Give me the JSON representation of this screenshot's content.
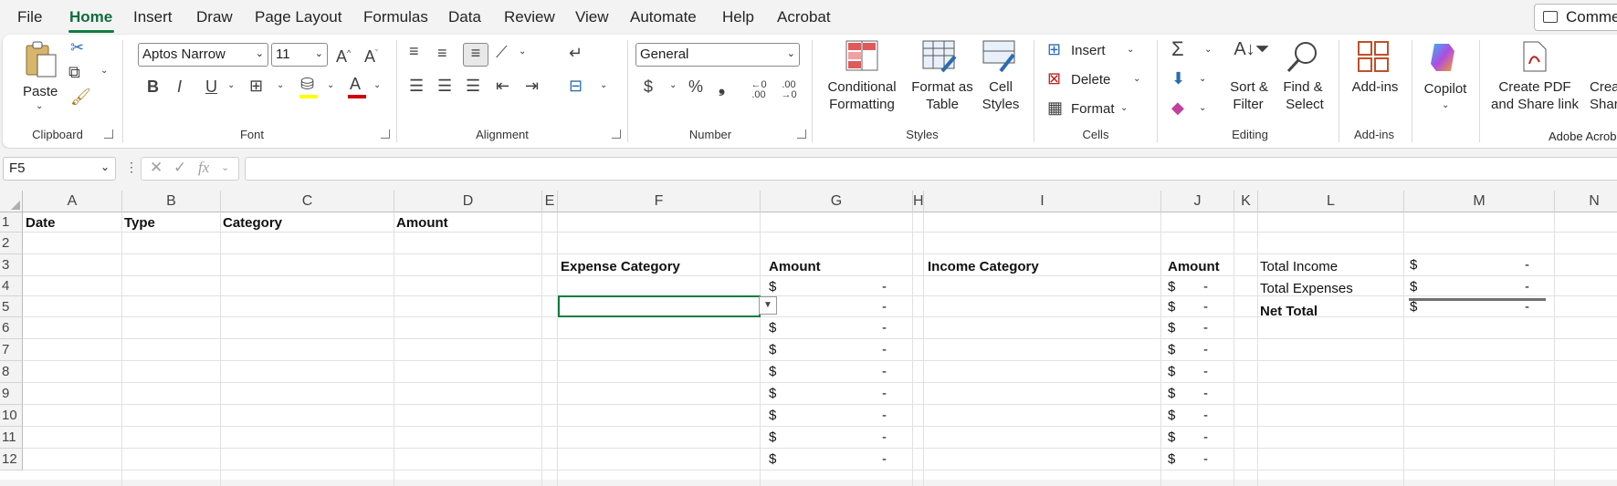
{
  "menu": {
    "tabs": [
      "File",
      "Home",
      "Insert",
      "Draw",
      "Page Layout",
      "Formulas",
      "Data",
      "Review",
      "View",
      "Automate",
      "Help",
      "Acrobat"
    ],
    "active": "Home",
    "comments": "Comments"
  },
  "ribbon": {
    "clipboard": {
      "label": "Clipboard",
      "paste": "Paste"
    },
    "font": {
      "label": "Font",
      "name": "Aptos Narrow",
      "size": "11",
      "bold": "B",
      "italic": "I",
      "underline": "U"
    },
    "alignment": {
      "label": "Alignment"
    },
    "number": {
      "label": "Number",
      "format": "General",
      "currency": "$",
      "percent": "%",
      "comma": "❟",
      "inc_dec": "←0 .00",
      "dec_dec": ".00 →0"
    },
    "styles": {
      "label": "Styles",
      "conditional_1": "Conditional",
      "conditional_2": "Formatting",
      "format_table_1": "Format as",
      "format_table_2": "Table",
      "cell_styles_1": "Cell",
      "cell_styles_2": "Styles"
    },
    "cells": {
      "label": "Cells",
      "insert": "Insert",
      "delete": "Delete",
      "format": "Format"
    },
    "editing": {
      "label": "Editing",
      "sort_1": "Sort &",
      "sort_2": "Filter",
      "find_1": "Find &",
      "find_2": "Select"
    },
    "addins": {
      "label": "Add-ins",
      "addins": "Add-ins"
    },
    "copilot": {
      "label": "Copilot"
    },
    "acrobat": {
      "label": "Adobe Acrobat",
      "create_1": "Create PDF",
      "create_2": "and Share link",
      "create2_1": "Create",
      "create2_2": "Share"
    }
  },
  "formula_bar": {
    "name_box": "F5",
    "fx": "fx",
    "formula": ""
  },
  "sheet": {
    "columns": [
      "A",
      "B",
      "C",
      "D",
      "E",
      "F",
      "G",
      "H",
      "I",
      "J",
      "K",
      "L",
      "M",
      "N"
    ],
    "rows": [
      "1",
      "2",
      "3",
      "4",
      "5",
      "6",
      "7",
      "8",
      "9",
      "10",
      "11",
      "12"
    ],
    "headers": {
      "date": "Date",
      "type": "Type",
      "category": "Category",
      "amount": "Amount"
    },
    "expense": {
      "header": "Expense Category",
      "amount_header": "Amount"
    },
    "income": {
      "header": "Income Category",
      "amount_header": "Amount"
    },
    "currency": "$",
    "dash": "-",
    "summary": {
      "total_income": "Total Income",
      "total_expenses": "Total Expenses",
      "net_total": "Net Total"
    }
  },
  "colors": {
    "accent": "#107c41",
    "sheet_bg": "#ffffff",
    "ribbon_bg": "#ffffff",
    "chrome_bg": "#f3f3f3"
  }
}
